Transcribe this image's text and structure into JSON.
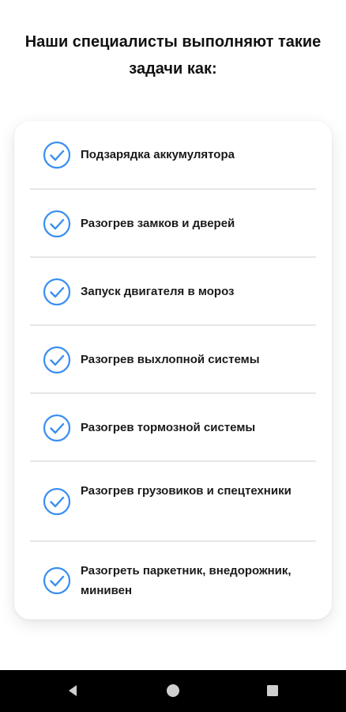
{
  "header": {
    "title": "Наши специалисты выполняют такие задачи как:"
  },
  "services": {
    "items": [
      {
        "label": "Подзарядка аккумулятора",
        "icon": "check-circle-icon"
      },
      {
        "label": "Разогрев замков и дверей",
        "icon": "check-circle-icon"
      },
      {
        "label": "Запуск двигателя в мороз",
        "icon": "check-circle-icon"
      },
      {
        "label": "Разогрев выхлопной системы",
        "icon": "check-circle-icon"
      },
      {
        "label": "Разогрев тормозной системы",
        "icon": "check-circle-icon"
      },
      {
        "label": "Разогрев грузовиков и спецтехники",
        "icon": "check-circle-icon"
      },
      {
        "label": "Разогреть паркетник, внедорожник, минивен",
        "icon": "check-circle-icon"
      }
    ]
  },
  "navigation_bar": {
    "buttons": [
      "back-icon",
      "home-icon",
      "recents-icon"
    ]
  },
  "colors": {
    "accent": "#3a8ff0",
    "text": "#1a1a1a",
    "divider": "#e6e6e6",
    "navbar": "#000000"
  }
}
